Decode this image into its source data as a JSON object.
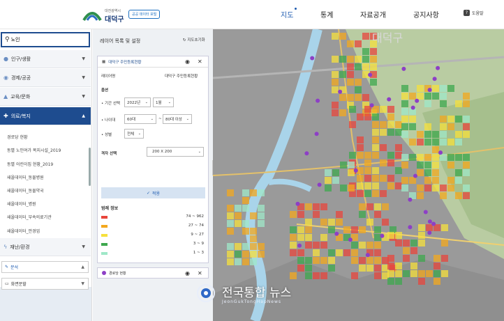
{
  "header": {
    "logo_small": "대전광역시",
    "logo_big": "대덕구",
    "logo_badge": "공공 데이터 포털",
    "nav": [
      "지도",
      "통계",
      "자료공개",
      "공지사항"
    ],
    "help": "도움말"
  },
  "sidebar": {
    "search": {
      "value": "노인",
      "placeholder": ""
    },
    "categories": [
      {
        "label": "인구/생활",
        "icon": "person-icon"
      },
      {
        "label": "경제/공공",
        "icon": "coin-icon"
      },
      {
        "label": "교육/문화",
        "icon": "education-icon"
      },
      {
        "label": "의료/복지",
        "icon": "medical-icon"
      }
    ],
    "subitems": [
      "경로당 현황",
      "동별 노인여가 복지시설_2019",
      "동별 어린이집 현황_2019",
      "새올데이터_동물병원",
      "새올데이터_동물약국",
      "새올데이터_병원",
      "새올데이터_부속의료기관",
      "새올데이터_안경업"
    ],
    "disaster": "재난/환경",
    "analysis": "분석",
    "screen_split": "화면분할"
  },
  "panel": {
    "title": "레이어 목록 및 설정",
    "reset": "지도초기화",
    "layer_name": "대덕구 주민등록현황",
    "layer_label": "레이어명",
    "layer_value": "대덕구 주민등록현황",
    "options_label": "옵션",
    "period_label": "• 기간 선택",
    "period_year": "2022년",
    "period_month": "1월",
    "age_label": "• 나이대",
    "age_from": "60대",
    "age_sep": "~",
    "age_to": "80대 이상",
    "gender_label": "• 성별",
    "gender_value": "전체",
    "grid_label": "격자 선택",
    "grid_value": "200 X 200",
    "apply": "적용",
    "legend_title": "범례 정보",
    "legend": [
      {
        "color": "#e8453c",
        "range": "74 ~ 962"
      },
      {
        "color": "#f3a81e",
        "range": "27 ~ 74"
      },
      {
        "color": "#f6e03c",
        "range": "9 ~ 27"
      },
      {
        "color": "#3ea84e",
        "range": "3 ~ 9"
      },
      {
        "color": "#9fe8c8",
        "range": "1 ~ 3"
      }
    ],
    "layer2_name": "경로당 현황"
  },
  "map": {
    "label": "대덕구",
    "watermark": "전국통합 뉴스",
    "watermark_sub": "JeonGukTongHapNews"
  }
}
